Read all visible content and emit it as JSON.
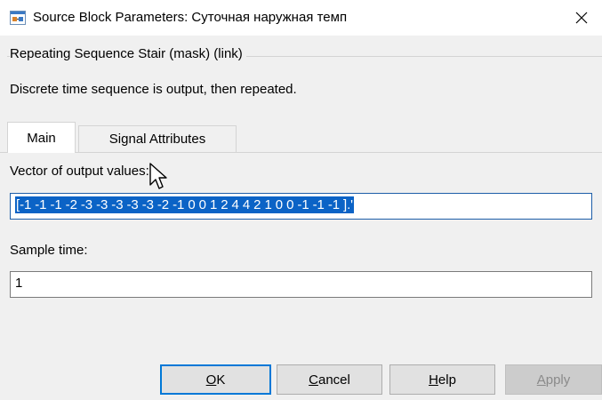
{
  "window": {
    "title": "Source Block Parameters: Суточная наружная темп",
    "close_glyph": "✕"
  },
  "group": {
    "legend": "Repeating Sequence Stair (mask) (link)",
    "description": "Discrete time sequence is output, then repeated."
  },
  "tabs": [
    {
      "label": "Main",
      "active": true
    },
    {
      "label": "Signal Attributes",
      "active": false
    }
  ],
  "fields": {
    "vector_label": "Vector of output values:",
    "vector_value": "[-1 -1 -1 -2 -3 -3 -3 -3 -3 -2 -1 0 0 1 2 4 4 2 1 0 0 -1 -1 -1 ].'",
    "sample_label": "Sample time:",
    "sample_value": "1"
  },
  "buttons": {
    "ok": {
      "mnemonic": "O",
      "rest": "K"
    },
    "cancel": {
      "mnemonic": "C",
      "rest": "ancel"
    },
    "help": {
      "mnemonic": "H",
      "rest": "elp"
    },
    "apply": {
      "mnemonic": "A",
      "rest": "pply",
      "enabled": false
    }
  },
  "colors": {
    "selection": "#0b63c6",
    "focus": "#0078d7",
    "background": "#f0f0f0"
  }
}
